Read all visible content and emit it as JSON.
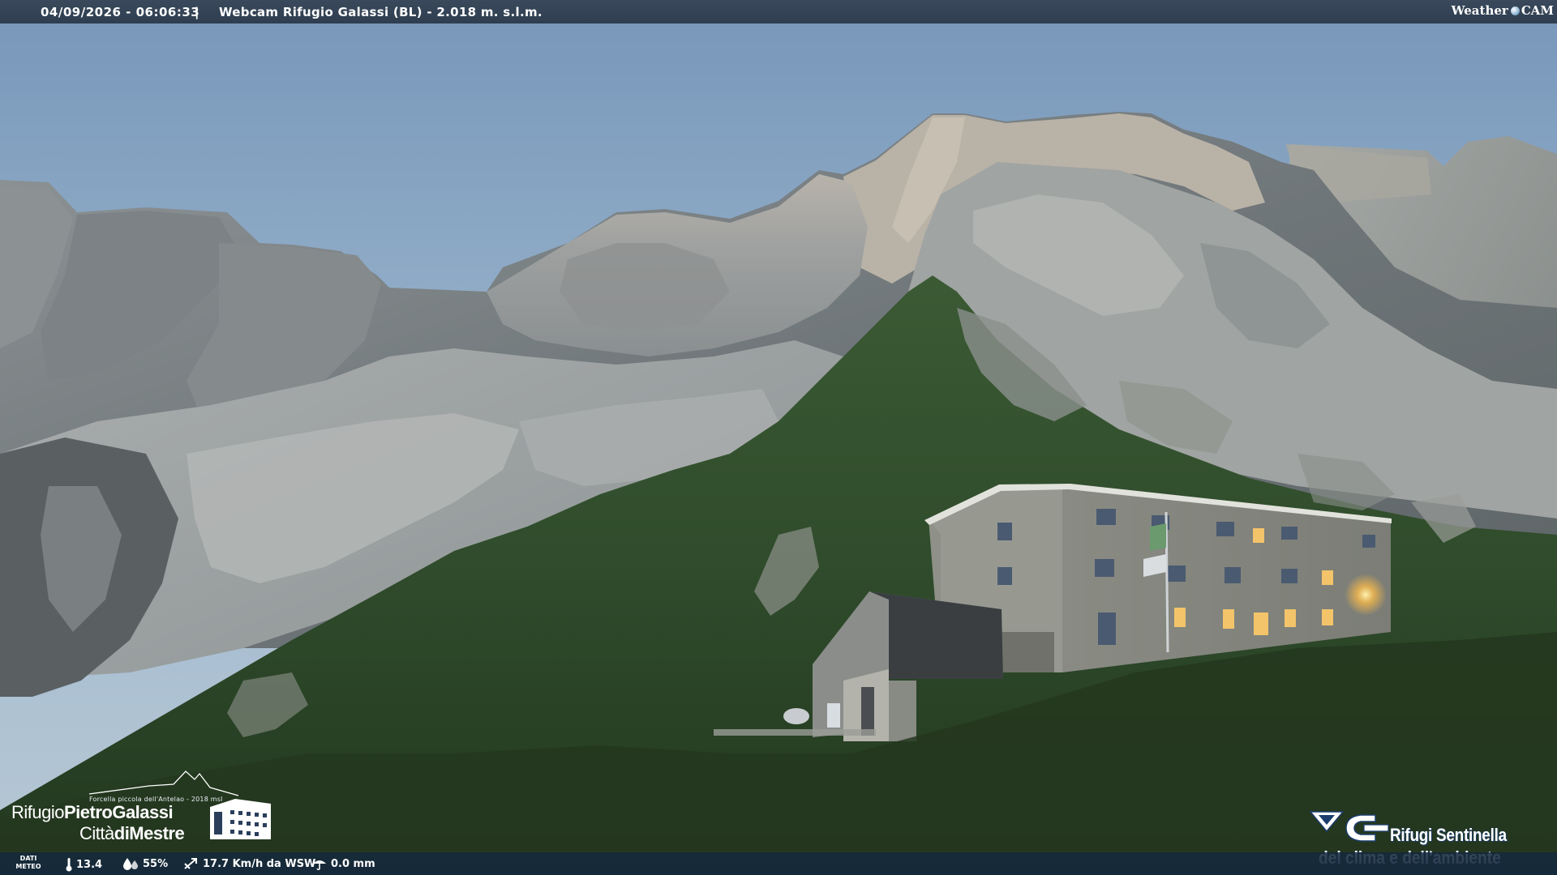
{
  "header": {
    "timestamp": "04/09/2026 - 06:06:33",
    "separator": "|",
    "title": "Webcam Rifugio Galassi (BL) - 2.018 m. s.l.m.",
    "brand_left": "Weather",
    "brand_right": "CAM"
  },
  "meteo": {
    "label_line1": "DATI",
    "label_line2": "METEO",
    "temperature": "13.4",
    "humidity": "55%",
    "wind": "17.7 Km/h da WSW",
    "rain": "0.0 mm",
    "icons": [
      "thermometer-icon",
      "humidity-icon",
      "wind-icon",
      "rain-icon"
    ]
  },
  "logo_left": {
    "subtitle": "Forcella piccola dell'Antelao - 2018 msl",
    "name_part1": "Rifugio",
    "name_part2": "PietroGalassi",
    "city_part1": "Città",
    "city_part2": "diMestre"
  },
  "logo_right": {
    "line1": "Rifugi Sentinella",
    "line2": "del clima e dell'ambiente"
  },
  "colors": {
    "sky_top": "#7d9cbd",
    "sky_bottom": "#a9c0d4",
    "rock": "#9a9c9c",
    "grass": "#2e4a2a",
    "window_light": "#f3c46a",
    "bar": "#2e3d4f"
  }
}
